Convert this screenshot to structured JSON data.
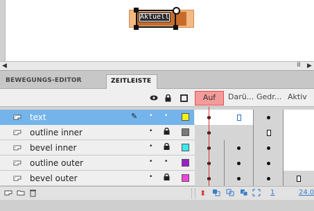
{
  "stage": {
    "text_field": "Aktuell"
  },
  "scroll": {
    "left_arrow": "◀",
    "grip": "III",
    "right_arrow": "▶"
  },
  "tabs": {
    "motion_editor": "BEWEGUNGS-EDITOR",
    "timeline": "ZEITLEISTE"
  },
  "header": {
    "frame_labels": [
      "Auf",
      "Darü...",
      "Gedr...",
      "Aktiv"
    ],
    "active_frame_label": "Auf"
  },
  "layers": [
    {
      "name": "text",
      "selected": true,
      "color": "#f2f215"
    },
    {
      "name": "outline inner",
      "selected": false,
      "color": "#7a7a7a"
    },
    {
      "name": "bevel inner",
      "selected": false,
      "color": "#38eaf0"
    },
    {
      "name": "outline outer",
      "selected": false,
      "color": "#9b20c8"
    },
    {
      "name": "bevel outer",
      "selected": false,
      "color": "#f045dd"
    }
  ],
  "bottom": {
    "current_frame": "1",
    "fps": "24.0"
  },
  "colors": {
    "accent_selected": "#74b4ea",
    "playhead": "#dd3333",
    "frame_label_highlight": "#f59a9a"
  }
}
